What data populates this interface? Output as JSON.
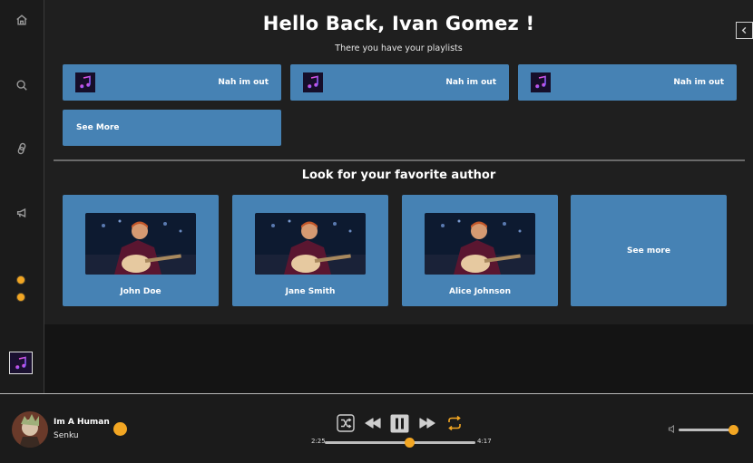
{
  "sidebar": {
    "icons": [
      "home-icon",
      "search-icon",
      "link-icon",
      "megaphone-icon"
    ],
    "dot_color": "#f2a623"
  },
  "header": {
    "greeting": "Hello Back, Ivan Gomez !",
    "subtitle": "There you have your playlists"
  },
  "playlists": {
    "items": [
      {
        "label": "Nah im out"
      },
      {
        "label": "Nah im out"
      },
      {
        "label": "Nah im out"
      }
    ],
    "see_more": "See More"
  },
  "authors": {
    "title": "Look for your favorite author",
    "items": [
      {
        "name": "John Doe"
      },
      {
        "name": "Jane Smith"
      },
      {
        "name": "Alice Johnson"
      }
    ],
    "see_more": "See more"
  },
  "player": {
    "track_title": "Im A Human",
    "artist": "Senku",
    "time_current": "2:25",
    "time_total": "4:17",
    "progress": 0.56,
    "volume": 0.99,
    "accent": "#f2a623"
  },
  "colors": {
    "card": "#4682b4",
    "background": "#1f1f1f",
    "accent": "#f2a623"
  }
}
